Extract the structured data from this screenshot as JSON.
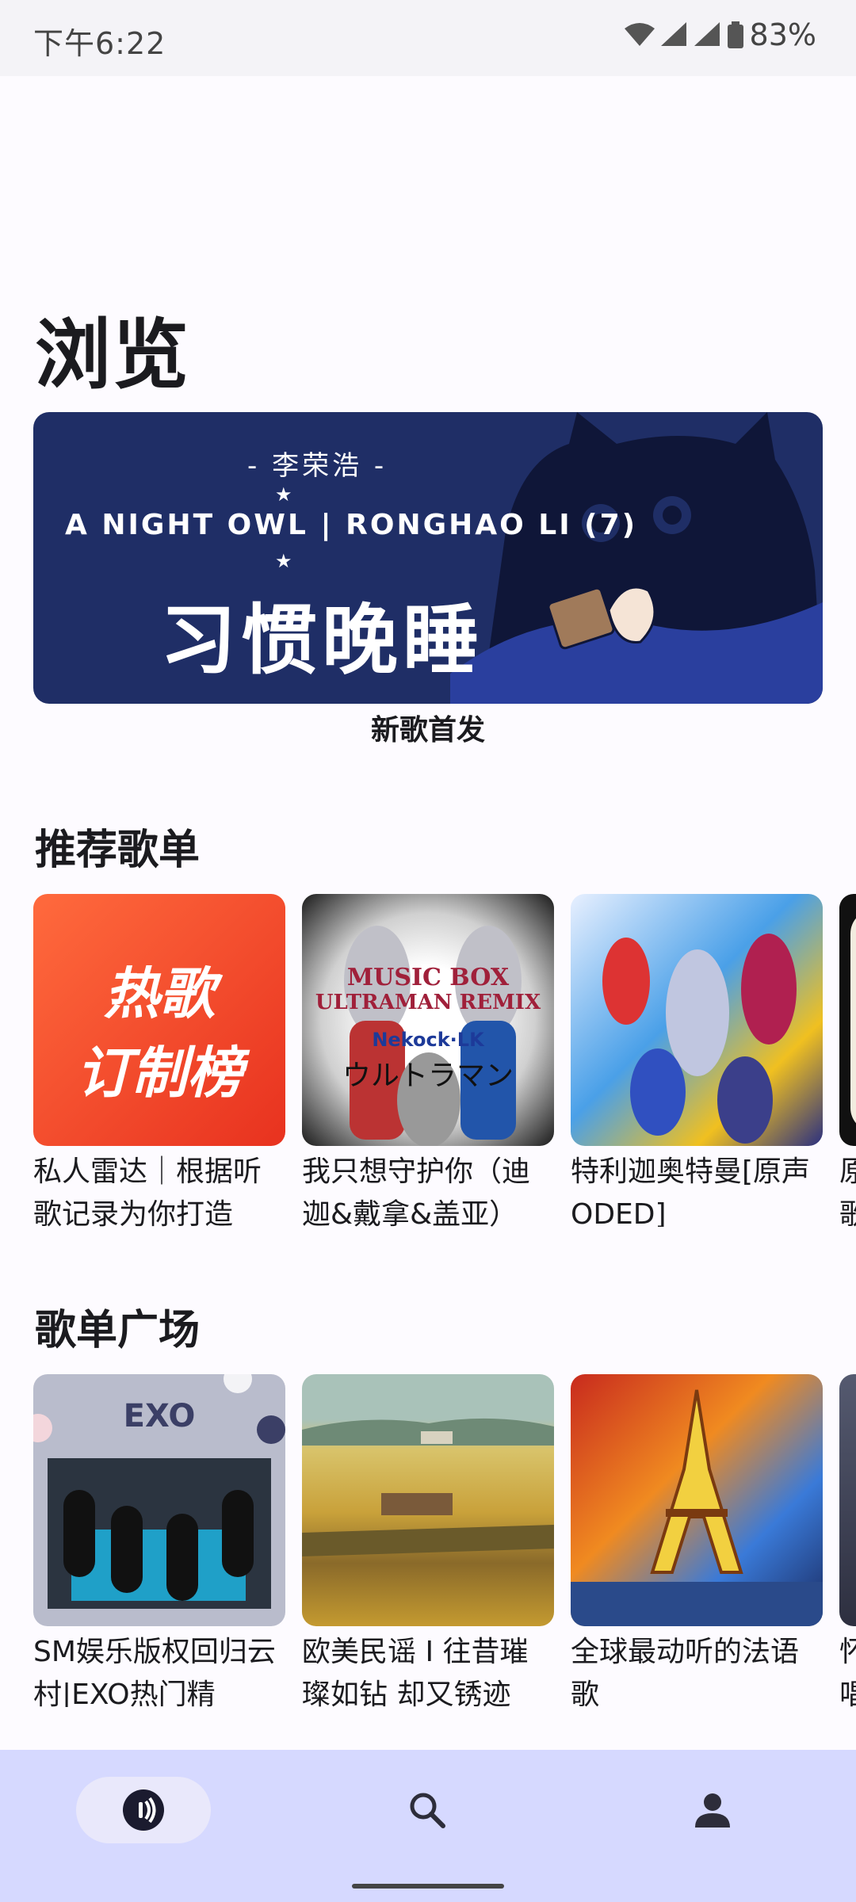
{
  "status_bar": {
    "time": "下午6:22",
    "battery": "83%"
  },
  "page": {
    "title": "浏览"
  },
  "banner": {
    "artist_line": "- 李荣浩 -",
    "english_line": "A NIGHT OWL | RONGHAO LI (7)",
    "album_title": "习惯晚睡",
    "caption": "新歌首发"
  },
  "recommended": {
    "title": "推荐歌单",
    "items": [
      {
        "label": "私人雷达｜根据听歌记录为你打造",
        "cover_text": [
          "热歌",
          "订制榜"
        ]
      },
      {
        "label": "我只想守护你（迪迦&戴拿&盖亚）",
        "cover_text": [
          "MUSIC BOX",
          "ULTRAMAN REMIX",
          "Nekock·LK",
          "ウルトラマン"
        ]
      },
      {
        "label": "特利迦奥特曼[原声ODED]"
      },
      {
        "label": "原歌"
      }
    ]
  },
  "plaza": {
    "title": "歌单广场",
    "items": [
      {
        "label": "SM娱乐版权回归云村|EXO热门精",
        "cover_text": "EXO"
      },
      {
        "label": "欧美民谣 I 往昔璀璨如钻 却又锈迹"
      },
      {
        "label": "全球最动听的法语歌"
      },
      {
        "label": "怀唱"
      }
    ]
  },
  "bottom_nav": [
    {
      "name": "music-icon"
    },
    {
      "name": "search-icon"
    },
    {
      "name": "person-icon"
    }
  ],
  "colors": {
    "background": "#fdfbff",
    "nav": "#d6d9ff",
    "banner": "#1f2e66"
  }
}
